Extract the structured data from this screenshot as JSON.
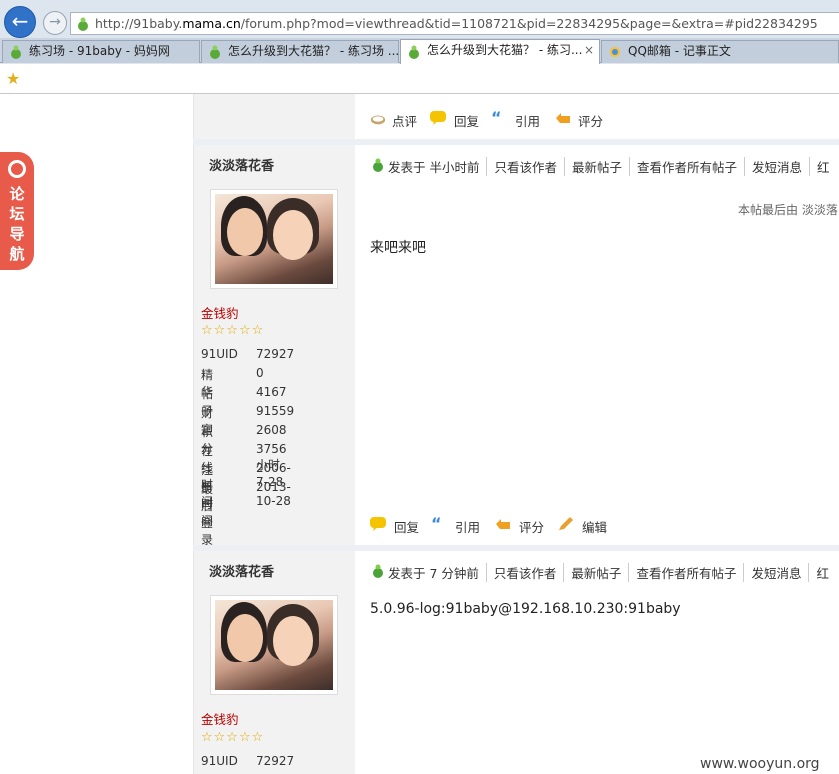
{
  "browser": {
    "url_prefix": "http://91baby.",
    "url_domain": "mama.cn",
    "url_rest": "/forum.php?mod=viewthread&tid=1108721&pid=22834295&page=&extra=#pid22834295",
    "tabs": [
      {
        "label": "练习场 - 91baby - 妈妈网",
        "close": ""
      },
      {
        "label": "怎么升级到大花猫？ - 练习场 ...",
        "close": ""
      },
      {
        "label": "怎么升级到大花猫？ - 练习...",
        "close": "×"
      },
      {
        "label": "QQ邮箱 - 记事正文",
        "close": ""
      }
    ]
  },
  "side_nav": {
    "label": "论坛导航"
  },
  "top_actions": {
    "comment": "点评",
    "reply": "回复",
    "quote": "引用",
    "rate": "评分"
  },
  "posts": [
    {
      "author": "淡淡落花香",
      "rank": "金钱豹",
      "stars": "☆☆☆☆☆",
      "stats": [
        {
          "k": "91UID",
          "v": "72927"
        },
        {
          "k": "精华",
          "v": "0"
        },
        {
          "k": "帖子",
          "v": "4167"
        },
        {
          "k": "财富",
          "v": "91559"
        },
        {
          "k": "积分",
          "v": "2608"
        },
        {
          "k": "在线时间",
          "v": "3756小时"
        },
        {
          "k": "注册时间",
          "v": "2006-7-28"
        },
        {
          "k": "最后登录",
          "v": "2013-10-28"
        }
      ],
      "posted": "发表于 半小时前",
      "links": [
        "只看该作者",
        "最新帖子",
        "查看作者所有帖子",
        "发短消息",
        "红"
      ],
      "last_edit": "本帖最后由 淡淡落",
      "content": "来吧来吧",
      "actions": {
        "reply": "回复",
        "quote": "引用",
        "rate": "评分",
        "edit": "编辑"
      }
    },
    {
      "author": "淡淡落花香",
      "rank": "金钱豹",
      "stars": "☆☆☆☆☆",
      "stats": [
        {
          "k": "91UID",
          "v": "72927"
        }
      ],
      "posted": "发表于 7 分钟前",
      "links": [
        "只看该作者",
        "最新帖子",
        "查看作者所有帖子",
        "发短消息",
        "红"
      ],
      "content": "5.0.96-log:91baby@192.168.10.230:91baby"
    }
  ],
  "watermark": "www.wooyun.org"
}
